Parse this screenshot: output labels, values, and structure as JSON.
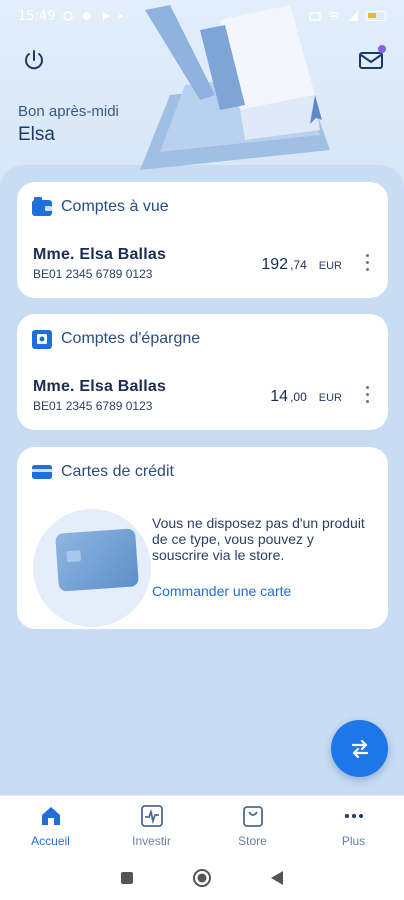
{
  "status_bar": {
    "time": "15:49"
  },
  "header": {
    "greeting": "Bon après-midi",
    "user_name": "Elsa",
    "icons": [
      "power-icon",
      "mail-icon"
    ]
  },
  "cards": {
    "current_accounts": {
      "title": "Comptes à vue",
      "holder": "Mme. Elsa Ballas",
      "iban": "BE01 2345 6789 0123",
      "amount_int": "192",
      "amount_dec": ",74",
      "currency": "EUR"
    },
    "savings_accounts": {
      "title": "Comptes d'épargne",
      "holder": "Mme. Elsa Ballas",
      "iban": "BE01 2345 6789 0123",
      "amount_int": "14",
      "amount_dec": ",00",
      "currency": "EUR"
    },
    "credit_cards": {
      "title": "Cartes de crédit",
      "message": "Vous ne disposez pas d'un produit de ce type, vous pouvez y souscrire via le store.",
      "link": "Commander une carte"
    }
  },
  "tabbar": {
    "items": [
      {
        "label": "Accueil",
        "icon": "home-icon",
        "active": true
      },
      {
        "label": "Investir",
        "icon": "chart-icon",
        "active": false
      },
      {
        "label": "Store",
        "icon": "bag-icon",
        "active": false
      },
      {
        "label": "Plus",
        "icon": "more-icon",
        "active": false
      }
    ]
  },
  "colors": {
    "accent": "#1e77e8",
    "background": "#c8dcf2",
    "card": "#ffffff",
    "title": "#2a4d80"
  }
}
